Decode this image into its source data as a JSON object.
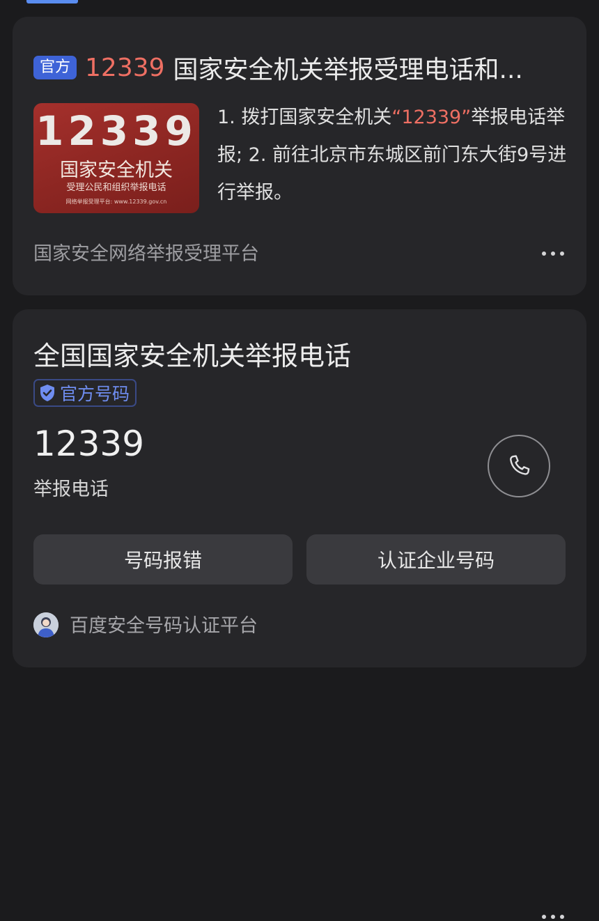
{
  "result1": {
    "tag": "官方",
    "title_number": "12339",
    "title_text": "国家安全机关举报受理电话和...",
    "thumbnail": {
      "number": "12339",
      "org": "国家安全机关",
      "subtitle": "受理公民和组织举报电话",
      "website": "网络举报受理平台: www.12339.gov.cn"
    },
    "description_prefix": "1. 拨打国家安全机关",
    "description_highlight": "“12339”",
    "description_suffix": "举报电话举报; 2. 前往北京市东城区前门东大街9号进行举报。",
    "source": "国家安全网络举报受理平台",
    "more_icon": "more-dots-icon"
  },
  "result2": {
    "title": "全国国家安全机关举报电话",
    "badge_label": "官方号码",
    "badge_icon": "shield-check-icon",
    "phone_number": "12339",
    "phone_label": "举报电话",
    "call_icon": "phone-icon",
    "report_error_label": "号码报错",
    "verify_label": "认证企业号码",
    "source": "百度安全号码认证平台",
    "more_icon": "more-dots-icon"
  },
  "colors": {
    "background": "#1b1b1d",
    "card": "#262629",
    "accent_blue": "#3e63d7",
    "highlight_red": "#ee6f63",
    "badge_text": "#6f8df0"
  }
}
